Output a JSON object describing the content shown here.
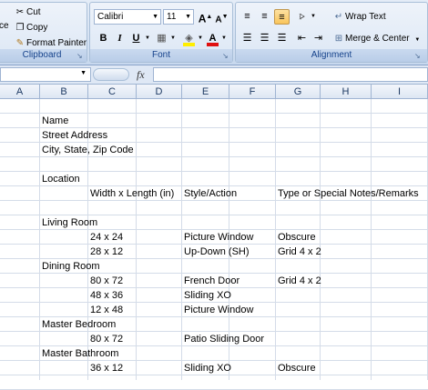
{
  "clipboard": {
    "paste_label": "ce",
    "cut_label": "Cut",
    "copy_label": "Copy",
    "format_painter_label": "Format Painter",
    "group_label": "Clipboard"
  },
  "font": {
    "font_name": "Calibri",
    "font_size": "11",
    "grow_label": "A",
    "shrink_label": "A",
    "bold_label": "B",
    "italic_label": "I",
    "underline_label": "U",
    "group_label": "Font"
  },
  "alignment": {
    "wrap_text_label": "Wrap Text",
    "merge_center_label": "Merge & Center",
    "group_label": "Alignment"
  },
  "formula_bar": {
    "fx_label": "fx",
    "value": ""
  },
  "columns": [
    "A",
    "B",
    "C",
    "D",
    "E",
    "F",
    "G",
    "H",
    "I"
  ],
  "cells": [
    {
      "row": 2,
      "col": "B",
      "text": "Name"
    },
    {
      "row": 3,
      "col": "B",
      "text": "Street Address"
    },
    {
      "row": 4,
      "col": "B",
      "text": "City, State, Zip Code"
    },
    {
      "row": 6,
      "col": "B",
      "text": " Location"
    },
    {
      "row": 7,
      "col": "C",
      "text": "Width x Length (in)"
    },
    {
      "row": 7,
      "col": "E",
      "text": "Style/Action"
    },
    {
      "row": 7,
      "col": "G",
      "text": "Type or Special Notes/Remarks"
    },
    {
      "row": 9,
      "col": "B",
      "text": "Living Room"
    },
    {
      "row": 10,
      "col": "C",
      "text": "24 x 24"
    },
    {
      "row": 10,
      "col": "E",
      "text": "Picture Window"
    },
    {
      "row": 10,
      "col": "G",
      "text": "Obscure"
    },
    {
      "row": 11,
      "col": "C",
      "text": "28 x 12"
    },
    {
      "row": 11,
      "col": "E",
      "text": "Up-Down (SH)"
    },
    {
      "row": 11,
      "col": "G",
      "text": "Grid 4 x 2"
    },
    {
      "row": 12,
      "col": "B",
      "text": "Dining Room"
    },
    {
      "row": 13,
      "col": "C",
      "text": "80 x 72"
    },
    {
      "row": 13,
      "col": "E",
      "text": "French Door"
    },
    {
      "row": 13,
      "col": "G",
      "text": "Grid 4 x 2"
    },
    {
      "row": 14,
      "col": "C",
      "text": "48 x 36"
    },
    {
      "row": 14,
      "col": "E",
      "text": "Sliding XO"
    },
    {
      "row": 15,
      "col": "C",
      "text": "12 x 48"
    },
    {
      "row": 15,
      "col": "E",
      "text": "Picture Window"
    },
    {
      "row": 16,
      "col": "B",
      "text": "Master Bedroom"
    },
    {
      "row": 17,
      "col": "C",
      "text": "80 x 72"
    },
    {
      "row": 17,
      "col": "E",
      "text": "Patio Sliding Door"
    },
    {
      "row": 18,
      "col": "B",
      "text": "Master Bathroom"
    },
    {
      "row": 19,
      "col": "C",
      "text": "36 x 12"
    },
    {
      "row": 19,
      "col": "E",
      "text": "Sliding XO"
    },
    {
      "row": 19,
      "col": "G",
      "text": "Obscure"
    }
  ],
  "colors": {
    "ribbon_label": "#15428b",
    "font_color_bar": "#e01010",
    "highlight_bar": "#ffee00",
    "header_text": "#1e3a63"
  }
}
